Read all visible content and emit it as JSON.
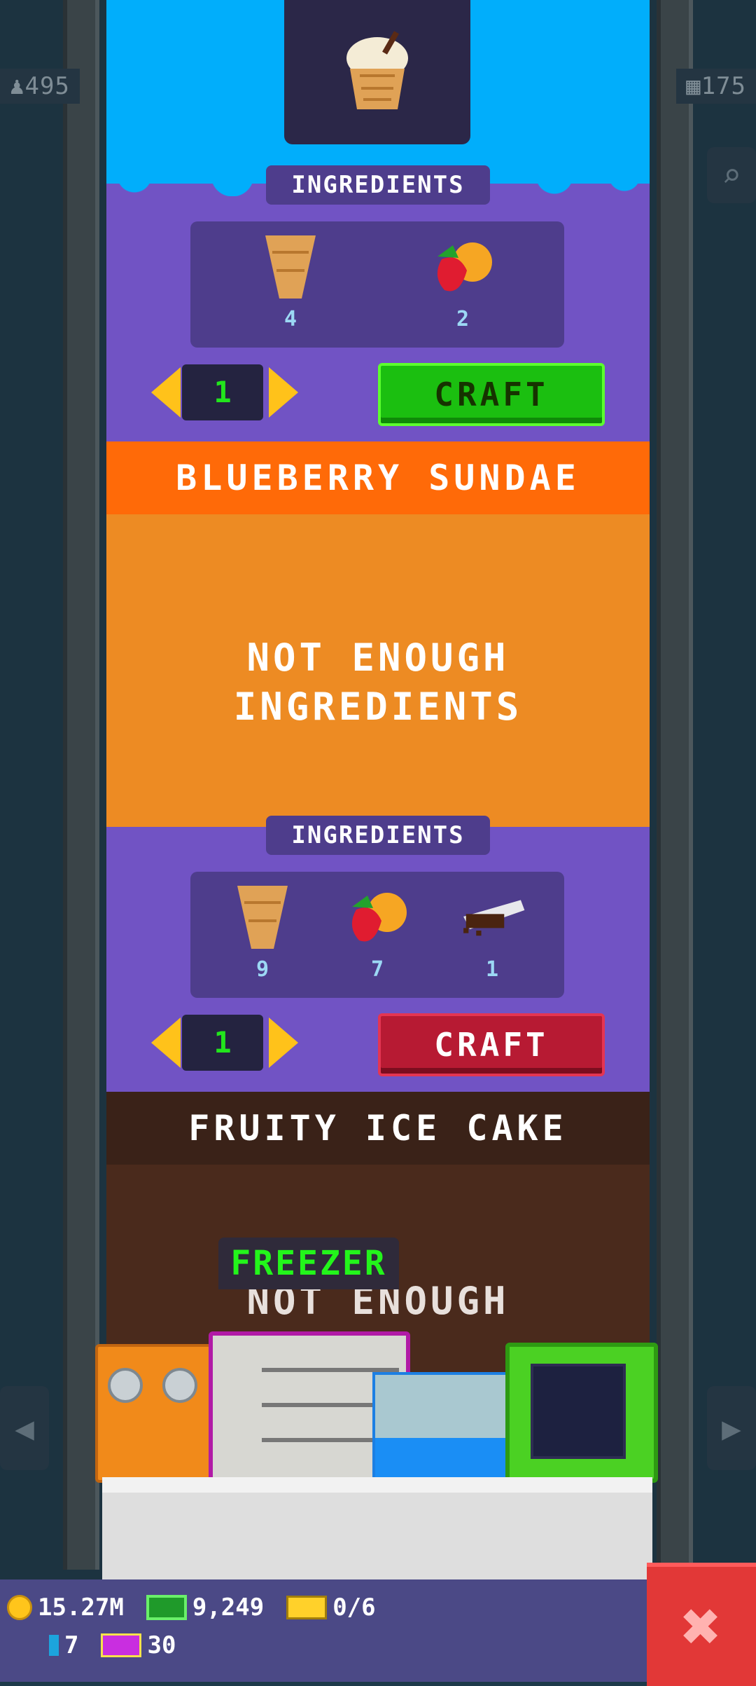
{
  "side": {
    "population": "495",
    "floors": "175"
  },
  "recipes": [
    {
      "ingredients_label": "INGREDIENTS",
      "ingredients": [
        {
          "icon": "cone-icon",
          "count": "4"
        },
        {
          "icon": "fruit-icon",
          "count": "2"
        }
      ],
      "quantity": "1",
      "craft_label": "CRAFT",
      "craft_state": "available"
    },
    {
      "title": "BLUEBERRY SUNDAE",
      "status_line1": "NOT ENOUGH",
      "status_line2": "INGREDIENTS",
      "ingredients_label": "INGREDIENTS",
      "ingredients": [
        {
          "icon": "cone-icon",
          "count": "9"
        },
        {
          "icon": "fruit-icon",
          "count": "7"
        },
        {
          "icon": "chocolate-icon",
          "count": "1"
        }
      ],
      "quantity": "1",
      "craft_label": "CRAFT",
      "craft_state": "unavailable"
    },
    {
      "title": "FRUITY ICE CAKE",
      "status_partial": "NOT ENOUGH"
    }
  ],
  "workstation": {
    "tooltip": "FREEZER"
  },
  "hud": {
    "coins": "15.27M",
    "bux_cash": "9,249",
    "tickets": "0/6",
    "gems": "7",
    "vip": "30"
  },
  "colors": {
    "panel": "#7153c4",
    "blue_hero": "#01aefb",
    "orange_title": "#ff6a08",
    "orange_hero": "#ed8b23",
    "brown_title": "#3a2218",
    "craft_green": "#1bbf10",
    "craft_red": "#b71a33",
    "close": "#e23837"
  }
}
